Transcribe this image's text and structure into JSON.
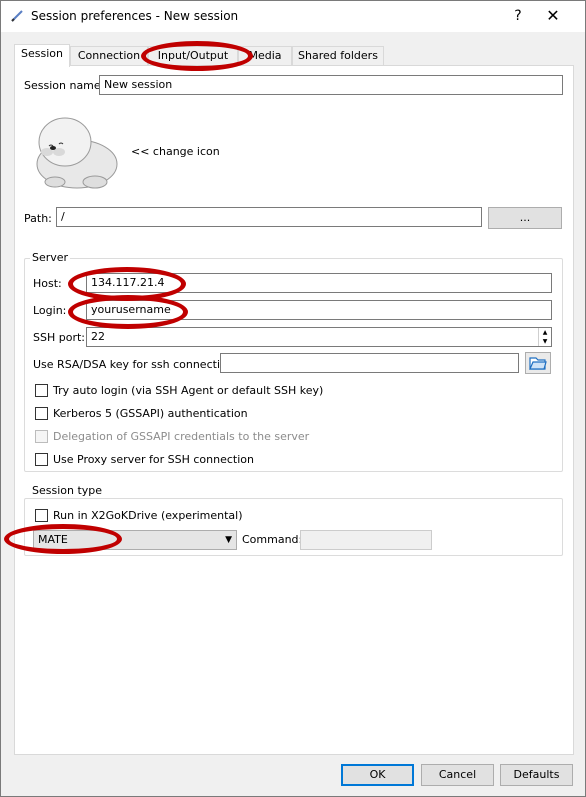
{
  "window": {
    "title": "Session preferences - New session",
    "help_label": "?",
    "close_label": "✕"
  },
  "tabs": [
    {
      "label": "Session",
      "active": true
    },
    {
      "label": "Connection"
    },
    {
      "label": "Input/Output"
    },
    {
      "label": "Media"
    },
    {
      "label": "Shared folders"
    }
  ],
  "session": {
    "name_label": "Session name:",
    "name_value": "New session",
    "change_icon_label": "<< change icon",
    "path_label": "Path:",
    "path_value": "/",
    "browse_label": "..."
  },
  "server": {
    "title": "Server",
    "host_label": "Host:",
    "host_value": "134.117.21.4",
    "login_label": "Login:",
    "login_value": "yourusername",
    "ssh_port_label": "SSH port:",
    "ssh_port_value": "22",
    "rsa_label": "Use RSA/DSA key for ssh connection:",
    "rsa_value": "",
    "auto_login_label": "Try auto login (via SSH Agent or default SSH key)",
    "kerberos_label": "Kerberos 5 (GSSAPI) authentication",
    "delegation_label": "Delegation of GSSAPI credentials to the server",
    "proxy_label": "Use Proxy server for SSH connection"
  },
  "session_type": {
    "title": "Session type",
    "x2godrive_label": "Run in X2GoKDrive (experimental)",
    "type_value": "MATE",
    "command_label": "Command:",
    "command_value": ""
  },
  "buttons": {
    "ok": "OK",
    "cancel": "Cancel",
    "defaults": "Defaults"
  },
  "annotation_color": "#c00000"
}
